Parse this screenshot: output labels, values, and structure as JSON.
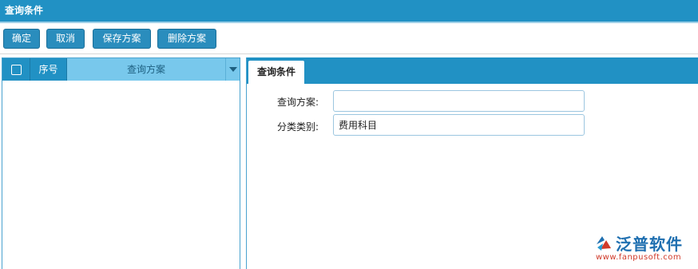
{
  "window": {
    "title": "查询条件"
  },
  "toolbar": {
    "confirm_label": "确定",
    "cancel_label": "取消",
    "save_plan_label": "保存方案",
    "delete_plan_label": "删除方案"
  },
  "plan_grid": {
    "columns": {
      "seq": "序号",
      "plan": "查询方案"
    }
  },
  "tabs": [
    {
      "label": "查询条件",
      "active": true
    }
  ],
  "form": {
    "query_plan": {
      "label": "查询方案:",
      "value": ""
    },
    "category": {
      "label": "分类类别:",
      "value": "费用科目"
    }
  },
  "logo": {
    "brand": "泛普软件",
    "url": "www.fanpusoft.com"
  },
  "colors": {
    "header": "#2191c4",
    "button": "#2a8dbd",
    "grid_highlight": "#78c8ec"
  }
}
